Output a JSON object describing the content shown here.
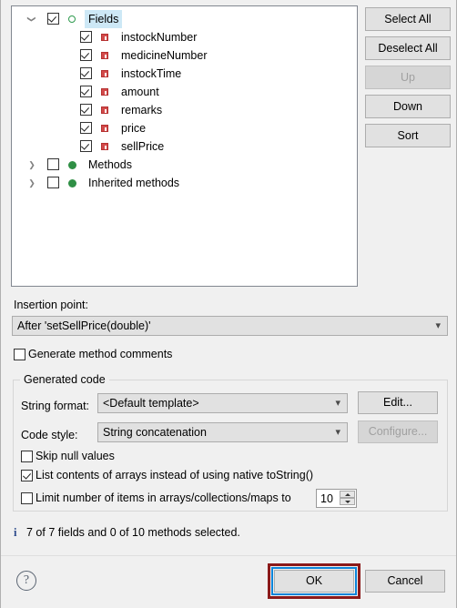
{
  "tree": {
    "nodes": [
      {
        "label": "Fields",
        "checked": true,
        "icon": "circle-outline-green-icon",
        "expanded": true,
        "selected": true,
        "depth": 0,
        "twisty": "chevron-down-icon"
      },
      {
        "label": "instockNumber",
        "checked": true,
        "icon": "field-square-red-icon",
        "depth": 1,
        "twisty": ""
      },
      {
        "label": "medicineNumber",
        "checked": true,
        "icon": "field-square-red-icon",
        "depth": 1,
        "twisty": ""
      },
      {
        "label": "instockTime",
        "checked": true,
        "icon": "field-square-red-icon",
        "depth": 1,
        "twisty": ""
      },
      {
        "label": "amount",
        "checked": true,
        "icon": "field-square-red-icon",
        "depth": 1,
        "twisty": ""
      },
      {
        "label": "remarks",
        "checked": true,
        "icon": "field-square-red-icon",
        "depth": 1,
        "twisty": ""
      },
      {
        "label": "price",
        "checked": true,
        "icon": "field-square-red-icon",
        "depth": 1,
        "twisty": ""
      },
      {
        "label": "sellPrice",
        "checked": true,
        "icon": "field-square-red-icon",
        "depth": 1,
        "twisty": ""
      },
      {
        "label": "Methods",
        "checked": false,
        "icon": "circle-filled-green-icon",
        "expanded": false,
        "depth": 0,
        "twisty": "chevron-right-icon"
      },
      {
        "label": "Inherited methods",
        "checked": false,
        "icon": "circle-filled-green-icon",
        "expanded": false,
        "depth": 0,
        "twisty": "chevron-right-icon"
      }
    ]
  },
  "side_buttons": [
    {
      "label": "Select All",
      "enabled": true
    },
    {
      "label": "Deselect All",
      "enabled": true
    },
    {
      "label": "Up",
      "enabled": false
    },
    {
      "label": "Down",
      "enabled": true
    },
    {
      "label": "Sort",
      "enabled": true
    }
  ],
  "insertion": {
    "label": "Insertion point:",
    "value": "After 'setSellPrice(double)'"
  },
  "generate_comments": {
    "label": "Generate method comments",
    "checked": false
  },
  "generated_code": {
    "title": "Generated code",
    "string_format": {
      "label": "String format:",
      "value": "<Default template>",
      "button": "Edit...",
      "button_enabled": true
    },
    "code_style": {
      "label": "Code style:",
      "value": "String concatenation",
      "button": "Configure...",
      "button_enabled": false
    },
    "options": [
      {
        "label": "Skip null values",
        "checked": false
      },
      {
        "label": "List contents of arrays instead of using native toString()",
        "checked": true
      },
      {
        "label": "Limit number of items in arrays/collections/maps to",
        "checked": false
      }
    ],
    "limit_value": "10"
  },
  "status": {
    "icon": "info-icon",
    "text": "7 of 7 fields and 0 of 10 methods selected."
  },
  "footer": {
    "help": "?",
    "ok": "OK",
    "cancel": "Cancel"
  },
  "colors": {
    "focus_ring": "#0b84d9",
    "annotation": "#8b1a1a",
    "selection": "#cde8f6",
    "field_icon": "#d24b4b",
    "method_icon": "#2f8f45"
  }
}
